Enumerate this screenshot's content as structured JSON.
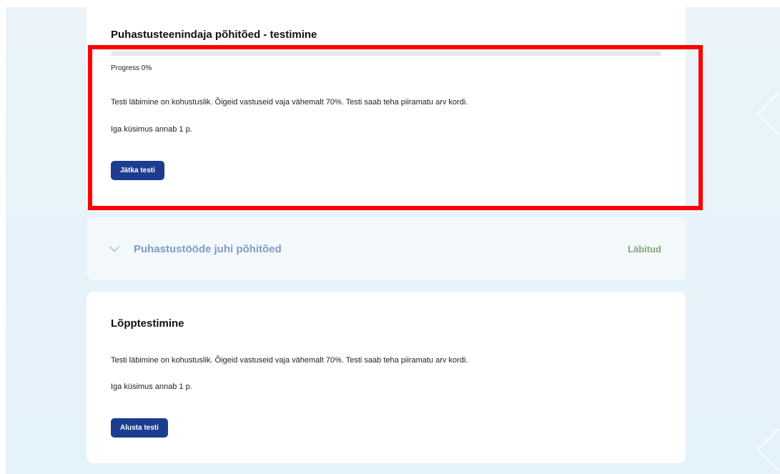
{
  "sections": [
    {
      "title": "Puhastusteenindaja põhitõed - testimine",
      "progress_label": "Progress 0%",
      "progress_value": 0,
      "description": "Testi läbimine on kohustuslik. Õigeid vastuseid vaja vähemalt 70%. Testi saab teha piiramatu arv kordi.",
      "points_note": "Iga küsimus annab 1 p.",
      "button_label": "Jätka testi"
    },
    {
      "title": "Puhastustööde juhi põhitõed",
      "status": "Läbitud",
      "collapsed": true
    },
    {
      "title": "Lõpptestimine",
      "description": "Testi läbimine on kohustuslik. Õigeid vastuseid vaja vähemalt 70%. Testi saab teha piiramatu arv kordi.",
      "points_note": "Iga küsimus annab 1 p.",
      "button_label": "Alusta testi"
    }
  ],
  "colors": {
    "primary_button": "#1c3d8f",
    "status_completed": "#7fa57a",
    "collapsed_title": "#7f9bc7",
    "highlight_frame": "#ff0000",
    "page_background": "#e4f2f9"
  },
  "icons": {
    "collapse_toggle": "chevron-down-icon"
  }
}
